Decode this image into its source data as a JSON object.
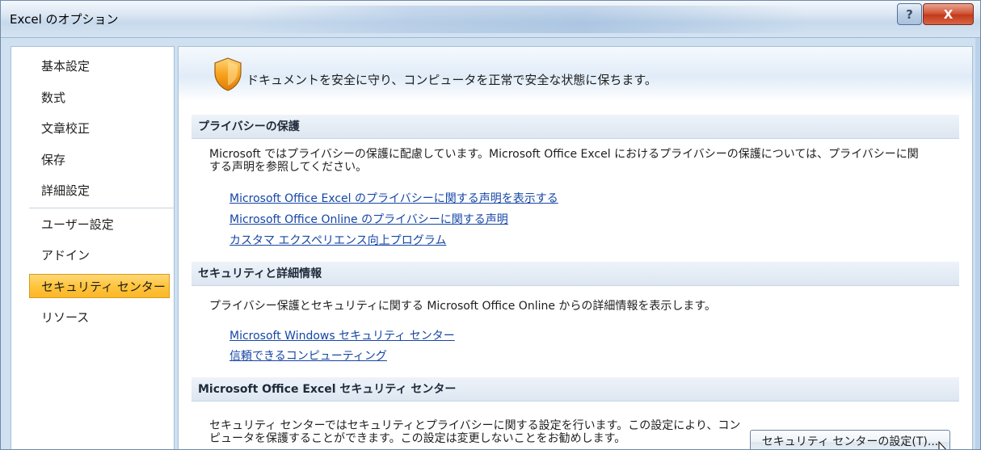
{
  "window": {
    "title": "Excel のオプション",
    "help_label": "?",
    "close_label": "X"
  },
  "sidebar": {
    "items": [
      {
        "label": "基本設定"
      },
      {
        "label": "数式"
      },
      {
        "label": "文章校正"
      },
      {
        "label": "保存"
      },
      {
        "label": "詳細設定"
      },
      {
        "label": "ユーザー設定"
      },
      {
        "label": "アドイン"
      },
      {
        "label": "セキュリティ センター",
        "active": true
      },
      {
        "label": "リソース"
      }
    ]
  },
  "banner": {
    "text": "ドキュメントを安全に守り、コンピュータを正常で安全な状態に保ちます。",
    "icon": "shield-icon"
  },
  "privacy": {
    "header": "プライバシーの保護",
    "text_line1": "Microsoft ではプライバシーの保護に配慮しています。Microsoft Office Excel におけるプライバシーの保護については、プライバシーに関",
    "text_line2": "する声明を参照してください。",
    "links": [
      "Microsoft Office Excel のプライバシーに関する声明を表示する",
      "Microsoft Office Online のプライバシーに関する声明",
      "カスタマ エクスペリエンス向上プログラム"
    ]
  },
  "security_info": {
    "header": "セキュリティと詳細情報",
    "text": "プライバシー保護とセキュリティに関する Microsoft Office Online からの詳細情報を表示します。",
    "links": [
      "Microsoft Windows セキュリティ センター",
      "信頼できるコンピューティング"
    ]
  },
  "trust_center": {
    "header": "Microsoft Office Excel セキュリティ センター",
    "text_line1": "セキュリティ センターではセキュリティとプライバシーに関する設定を行います。この設定により、コン",
    "text_line2": "ピュータを保護することができます。この設定は変更しないことをお勧めします。",
    "button_label": "セキュリティ センターの設定(T)..."
  },
  "colors": {
    "accent": "#ffc53d",
    "link": "#1546a6",
    "close": "#c23a1b"
  }
}
